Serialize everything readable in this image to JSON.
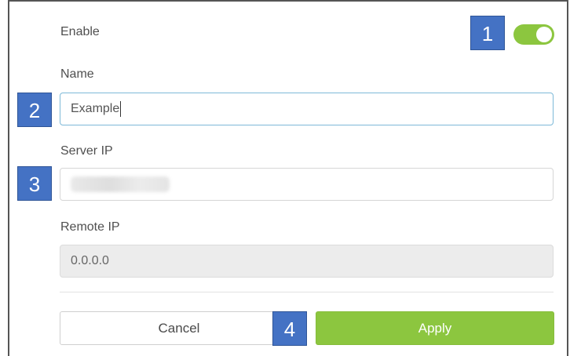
{
  "form": {
    "enable_label": "Enable",
    "enable_state": true,
    "name_label": "Name",
    "name_value": "Example",
    "server_ip_label": "Server IP",
    "remote_ip_label": "Remote IP",
    "remote_ip_value": "0.0.0.0"
  },
  "buttons": {
    "cancel": "Cancel",
    "apply": "Apply"
  },
  "callouts": [
    "1",
    "2",
    "3",
    "4"
  ],
  "colors": {
    "accent_green": "#8cc63f",
    "callout_blue": "#4472c4",
    "focus_border": "#7db9d8"
  }
}
